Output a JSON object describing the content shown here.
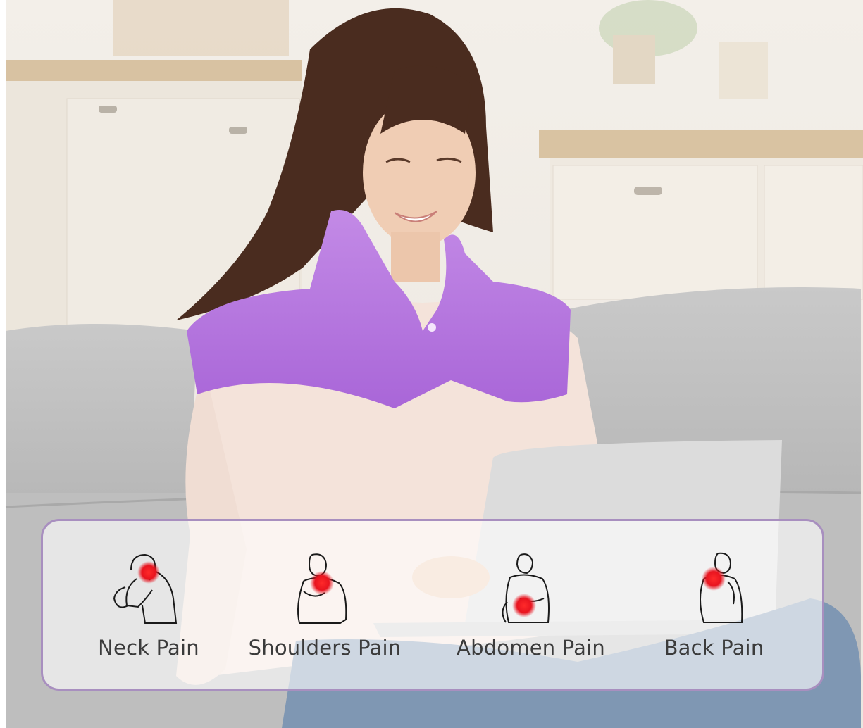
{
  "pain_areas": [
    {
      "label": "Neck Pain",
      "icon": "neck-pain-figure-icon"
    },
    {
      "label": "Shoulders Pain",
      "icon": "shoulder-pain-figure-icon"
    },
    {
      "label": "Abdomen Pain",
      "icon": "abdomen-pain-figure-icon"
    },
    {
      "label": "Back Pain",
      "icon": "back-pain-figure-icon"
    }
  ],
  "colors": {
    "wrap_purple": "#b77be0",
    "pain_dot": "#e8141f",
    "strip_border": "#a88fbf"
  }
}
